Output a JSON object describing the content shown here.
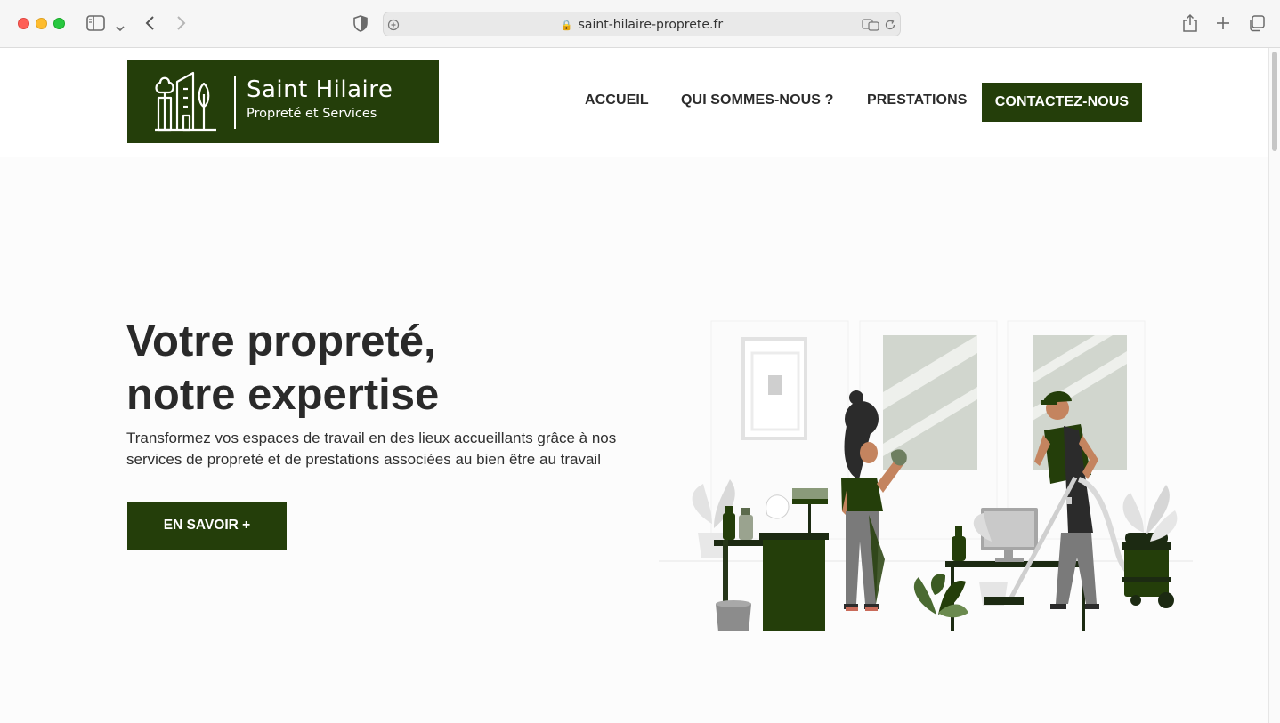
{
  "browser": {
    "url": "saint-hilaire-proprete.fr"
  },
  "logo": {
    "title": "Saint Hilaire",
    "subtitle": "Propreté et Services"
  },
  "nav": {
    "home": "ACCUEIL",
    "about": "QUI SOMMES-NOUS ?",
    "services": "PRESTATIONS",
    "contact": "CONTACTEZ-NOUS"
  },
  "hero": {
    "title_line1": "Votre propreté,",
    "title_line2": "notre expertise",
    "text": "Transformez vos espaces de travail en des lieux accueillants grâce à nos services de propreté et de prestations associées au bien être au travail",
    "cta": "EN SAVOIR +"
  },
  "colors": {
    "brand_green": "#243e0a",
    "text_dark": "#2a2a2a"
  },
  "icons": [
    "sidebar-icon",
    "chevron-down-icon",
    "back-icon",
    "forward-icon",
    "shield-icon",
    "lock-icon",
    "translate-icon",
    "reload-icon",
    "share-icon",
    "new-tab-icon",
    "tabs-icon"
  ]
}
